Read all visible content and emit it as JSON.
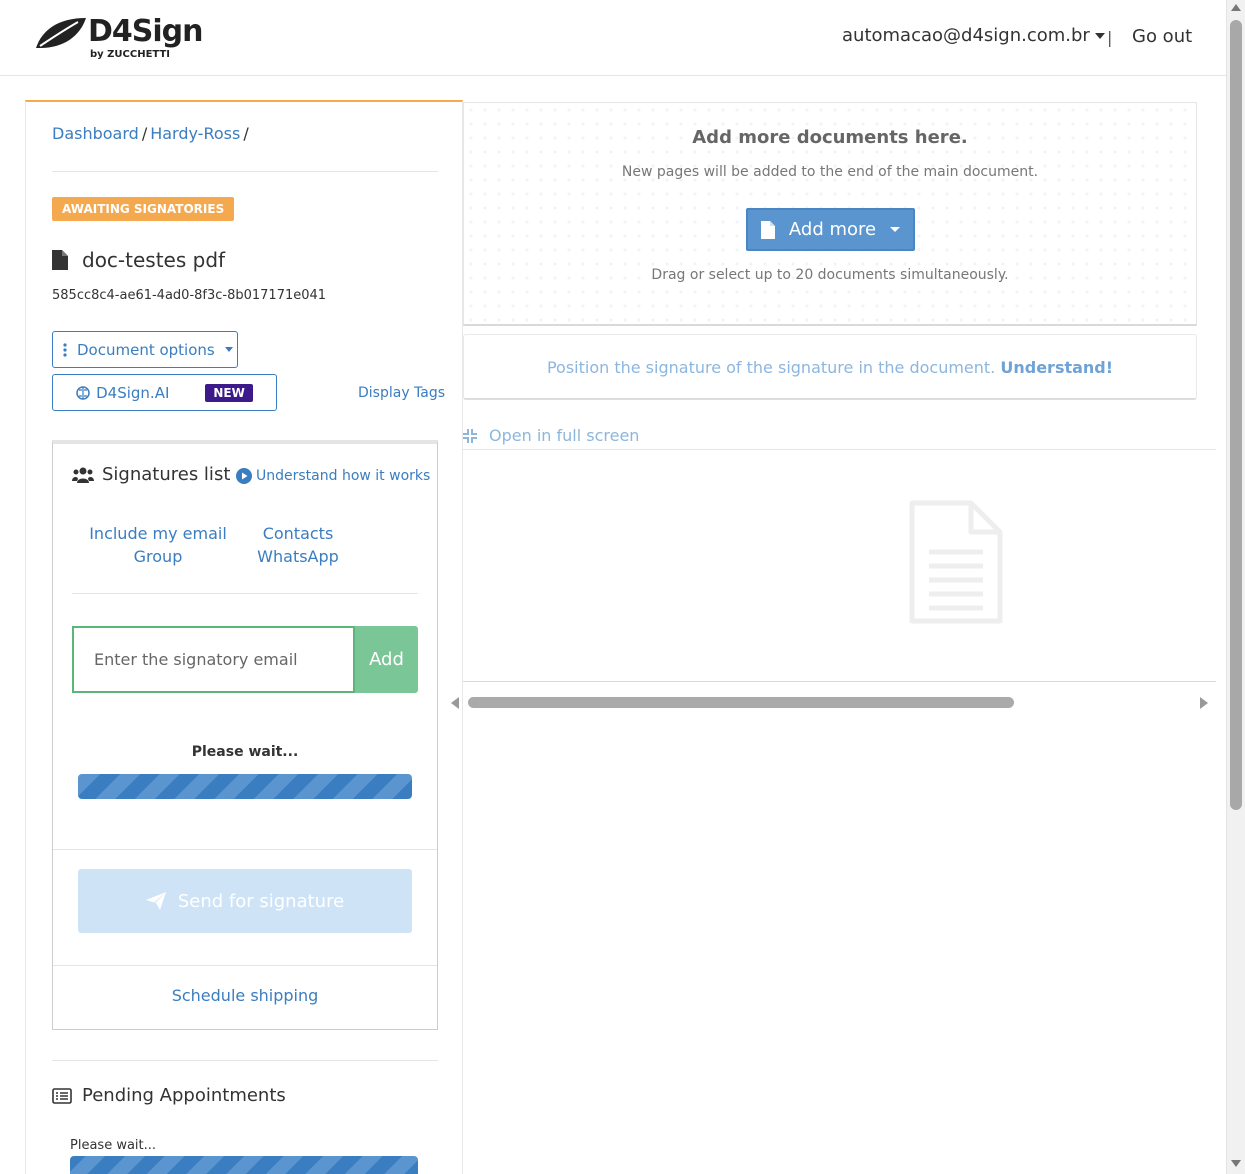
{
  "header": {
    "logo_text": "D4Sign",
    "logo_sub": "by ZUCCHETTI",
    "user_email": "automacao@d4sign.com.br",
    "separator": "|",
    "logout_label": "Go out"
  },
  "breadcrumb": [
    {
      "label": "Dashboard"
    },
    {
      "label": "Hardy-Ross"
    }
  ],
  "breadcrumb_sep": "/",
  "document": {
    "status": "AWAITING SIGNATORIES",
    "title": "doc-testes pdf",
    "id": "585cc8c4-ae61-4ad0-8f3c-8b017171e041",
    "options_label": "Document options",
    "ai_label": "D4Sign.AI",
    "ai_badge": "NEW",
    "display_tags_label": "Display Tags"
  },
  "signatures": {
    "title": "Signatures list",
    "understand_label": "Understand how it works",
    "include_email": "Include my email",
    "contacts": "Contacts",
    "group": "Group",
    "whatsapp": "WhatsApp",
    "email_placeholder": "Enter the signatory email",
    "add_label": "Add",
    "wait_label": "Please wait...",
    "send_label": "Send for signature",
    "schedule_label": "Schedule shipping"
  },
  "pending": {
    "title": "Pending Appointments",
    "wait_label": "Please wait..."
  },
  "upload": {
    "title": "Add more documents here.",
    "subtitle": "New pages will be added to the end of the main document.",
    "button_label": "Add more",
    "hint": "Drag or select up to 20 documents simultaneously."
  },
  "position": {
    "text": "Position the signature of the signature in the document.",
    "link": "Understand!"
  },
  "viewer": {
    "fullscreen_label": "Open in full screen"
  },
  "colors": {
    "accent": "#3a7dc0",
    "status_orange": "#f5a94f",
    "add_green": "#7bc697",
    "new_badge": "#3d1a8c"
  }
}
